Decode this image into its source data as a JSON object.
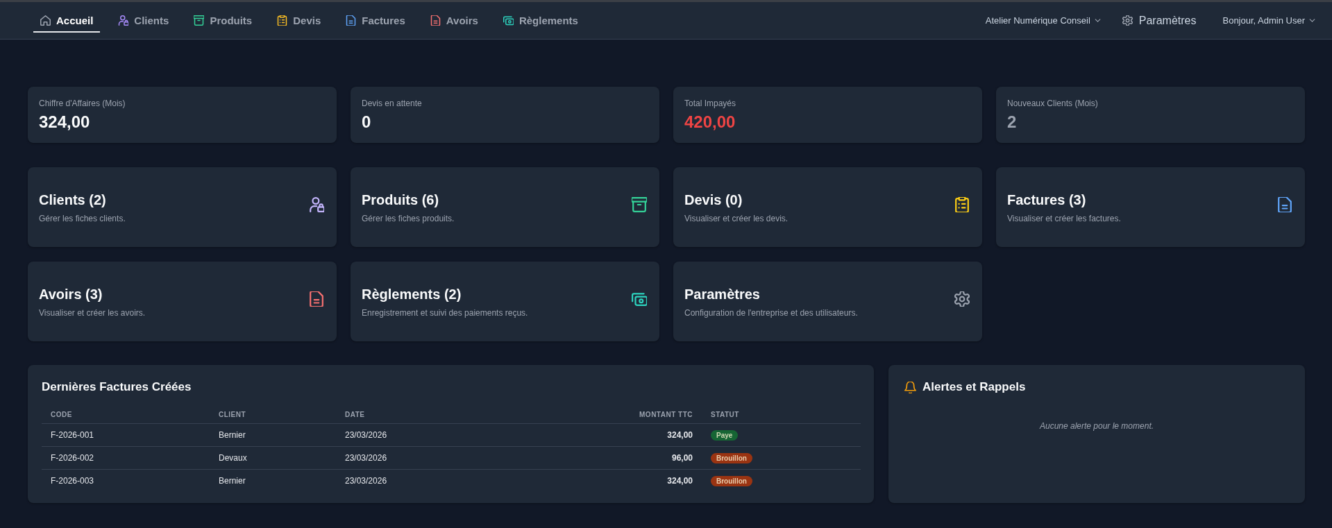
{
  "nav": {
    "tabs": [
      {
        "label": "Accueil",
        "kind": "home",
        "color": "#9ca3af",
        "selected": true
      },
      {
        "label": "Clients",
        "kind": "clients",
        "color": "#a78bfa",
        "selected": false
      },
      {
        "label": "Produits",
        "kind": "products",
        "color": "#34d399",
        "selected": false
      },
      {
        "label": "Devis",
        "kind": "quotes",
        "color": "#fbbf24",
        "selected": false
      },
      {
        "label": "Factures",
        "kind": "invoices",
        "color": "#60a5fa",
        "selected": false
      },
      {
        "label": "Avoirs",
        "kind": "credits",
        "color": "#f87171",
        "selected": false
      },
      {
        "label": "Règlements",
        "kind": "payments",
        "color": "#2dd4bf",
        "selected": false
      }
    ],
    "company": {
      "label": "Atelier Numérique Conseil"
    },
    "settings": {
      "label": "Paramètres"
    },
    "user": {
      "label": "Bonjour, Admin User"
    }
  },
  "stats": [
    {
      "label": "Chiffre d'Affaires (Mois)",
      "value": "324,00",
      "color": "#f9fafb"
    },
    {
      "label": "Devis en attente",
      "value": "0",
      "color": "#f9fafb"
    },
    {
      "label": "Total Impayés",
      "value": "420,00",
      "color": "#ef4444"
    },
    {
      "label": "Nouveaux Clients (Mois)",
      "value": "2",
      "color": "#9ca3af"
    }
  ],
  "modules": [
    {
      "title": "Clients (2)",
      "description": "Gérer les fiches clients.",
      "kind": "clients",
      "color": "#c4b5fd"
    },
    {
      "title": "Produits (6)",
      "description": "Gérer les fiches produits.",
      "kind": "products",
      "color": "#34d399"
    },
    {
      "title": "Devis (0)",
      "description": "Visualiser et créer les devis.",
      "kind": "quotes",
      "color": "#facc15"
    },
    {
      "title": "Factures (3)",
      "description": "Visualiser et créer les factures.",
      "kind": "invoices",
      "color": "#60a5fa"
    },
    {
      "title": "Avoirs (3)",
      "description": "Visualiser et créer les avoirs.",
      "kind": "credits",
      "color": "#f87171"
    },
    {
      "title": "Règlements (2)",
      "description": "Enregistrement et suivi des paiements reçus.",
      "kind": "payments",
      "color": "#2dd4bf"
    },
    {
      "title": "Paramètres",
      "description": "Configuration de l'entreprise et des utilisateurs.",
      "kind": "settings",
      "color": "#9ca3af"
    }
  ],
  "invoices": {
    "title": "Dernières Factures Créées",
    "columns": [
      "CODE",
      "CLIENT",
      "DATE",
      "MONTANT TTC",
      "STATUT"
    ],
    "rows": [
      {
        "code": "F-2026-001",
        "client": "Bernier",
        "date": "23/03/2026",
        "amount": "324,00",
        "status": {
          "label": "Paye",
          "color": "#166534"
        }
      },
      {
        "code": "F-2026-002",
        "client": "Devaux",
        "date": "23/03/2026",
        "amount": "96,00",
        "status": {
          "label": "Brouillon",
          "color": "#9a3412"
        }
      },
      {
        "code": "F-2026-003",
        "client": "Bernier",
        "date": "23/03/2026",
        "amount": "324,00",
        "status": {
          "label": "Brouillon",
          "color": "#9a3412"
        }
      }
    ]
  },
  "alerts": {
    "title": "Alertes et Rappels",
    "empty_message": "Aucune alerte pour le moment."
  }
}
